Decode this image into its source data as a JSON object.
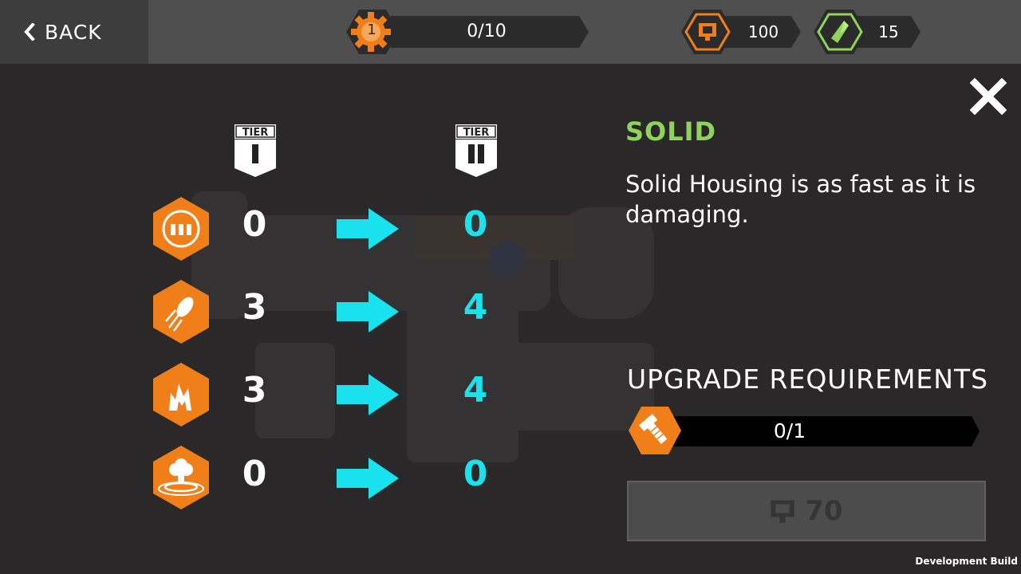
{
  "topbar": {
    "back_label": "BACK",
    "level_value": "1",
    "level_progress": "0/10",
    "currency_primary": "100",
    "currency_secondary": "15"
  },
  "colors": {
    "orange": "#f07f1a",
    "cyan": "#19e2ee",
    "green": "#8fd35a"
  },
  "tiers": {
    "label": "TIER",
    "current_numeral": "I",
    "next_numeral": "II"
  },
  "stats": [
    {
      "icon": "ammo-cycle-icon",
      "current": "0",
      "next": "0"
    },
    {
      "icon": "projectile-speed-icon",
      "current": "3",
      "next": "4"
    },
    {
      "icon": "fire-damage-icon",
      "current": "3",
      "next": "4"
    },
    {
      "icon": "explosion-radius-icon",
      "current": "0",
      "next": "0"
    }
  ],
  "part": {
    "name": "SOLID",
    "description": "Solid Housing is as fast as it is damaging."
  },
  "requirements": {
    "title": "UPGRADE REQUIREMENTS",
    "item_icon": "bolt-icon",
    "progress": "0/1"
  },
  "upgrade_button": {
    "cost": "70",
    "icon": "parts-currency-icon"
  },
  "footer": {
    "dev_label": "Development Build"
  }
}
